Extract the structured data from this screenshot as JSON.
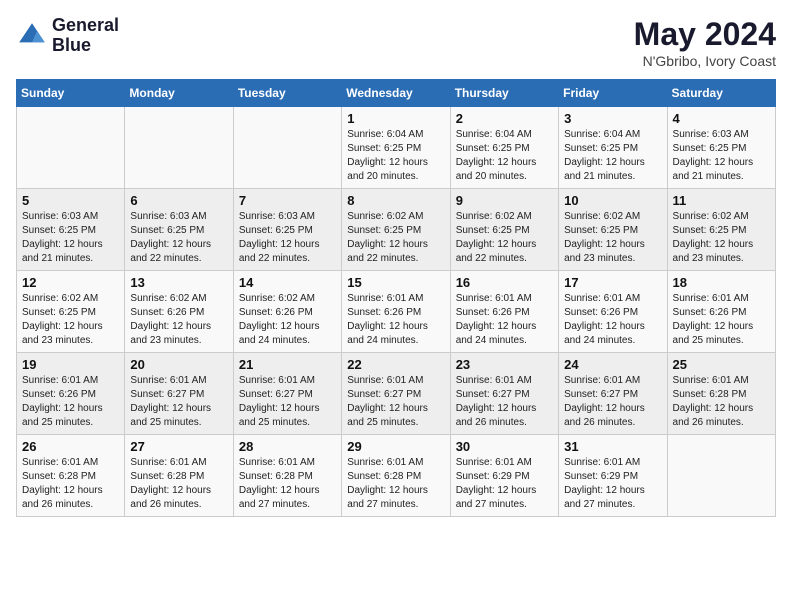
{
  "header": {
    "logo_line1": "General",
    "logo_line2": "Blue",
    "month_year": "May 2024",
    "location": "N'Gbribo, Ivory Coast"
  },
  "weekdays": [
    "Sunday",
    "Monday",
    "Tuesday",
    "Wednesday",
    "Thursday",
    "Friday",
    "Saturday"
  ],
  "weeks": [
    [
      {
        "day": "",
        "sunrise": "",
        "sunset": "",
        "daylight": ""
      },
      {
        "day": "",
        "sunrise": "",
        "sunset": "",
        "daylight": ""
      },
      {
        "day": "",
        "sunrise": "",
        "sunset": "",
        "daylight": ""
      },
      {
        "day": "1",
        "sunrise": "Sunrise: 6:04 AM",
        "sunset": "Sunset: 6:25 PM",
        "daylight": "Daylight: 12 hours and 20 minutes."
      },
      {
        "day": "2",
        "sunrise": "Sunrise: 6:04 AM",
        "sunset": "Sunset: 6:25 PM",
        "daylight": "Daylight: 12 hours and 20 minutes."
      },
      {
        "day": "3",
        "sunrise": "Sunrise: 6:04 AM",
        "sunset": "Sunset: 6:25 PM",
        "daylight": "Daylight: 12 hours and 21 minutes."
      },
      {
        "day": "4",
        "sunrise": "Sunrise: 6:03 AM",
        "sunset": "Sunset: 6:25 PM",
        "daylight": "Daylight: 12 hours and 21 minutes."
      }
    ],
    [
      {
        "day": "5",
        "sunrise": "Sunrise: 6:03 AM",
        "sunset": "Sunset: 6:25 PM",
        "daylight": "Daylight: 12 hours and 21 minutes."
      },
      {
        "day": "6",
        "sunrise": "Sunrise: 6:03 AM",
        "sunset": "Sunset: 6:25 PM",
        "daylight": "Daylight: 12 hours and 22 minutes."
      },
      {
        "day": "7",
        "sunrise": "Sunrise: 6:03 AM",
        "sunset": "Sunset: 6:25 PM",
        "daylight": "Daylight: 12 hours and 22 minutes."
      },
      {
        "day": "8",
        "sunrise": "Sunrise: 6:02 AM",
        "sunset": "Sunset: 6:25 PM",
        "daylight": "Daylight: 12 hours and 22 minutes."
      },
      {
        "day": "9",
        "sunrise": "Sunrise: 6:02 AM",
        "sunset": "Sunset: 6:25 PM",
        "daylight": "Daylight: 12 hours and 22 minutes."
      },
      {
        "day": "10",
        "sunrise": "Sunrise: 6:02 AM",
        "sunset": "Sunset: 6:25 PM",
        "daylight": "Daylight: 12 hours and 23 minutes."
      },
      {
        "day": "11",
        "sunrise": "Sunrise: 6:02 AM",
        "sunset": "Sunset: 6:25 PM",
        "daylight": "Daylight: 12 hours and 23 minutes."
      }
    ],
    [
      {
        "day": "12",
        "sunrise": "Sunrise: 6:02 AM",
        "sunset": "Sunset: 6:25 PM",
        "daylight": "Daylight: 12 hours and 23 minutes."
      },
      {
        "day": "13",
        "sunrise": "Sunrise: 6:02 AM",
        "sunset": "Sunset: 6:26 PM",
        "daylight": "Daylight: 12 hours and 23 minutes."
      },
      {
        "day": "14",
        "sunrise": "Sunrise: 6:02 AM",
        "sunset": "Sunset: 6:26 PM",
        "daylight": "Daylight: 12 hours and 24 minutes."
      },
      {
        "day": "15",
        "sunrise": "Sunrise: 6:01 AM",
        "sunset": "Sunset: 6:26 PM",
        "daylight": "Daylight: 12 hours and 24 minutes."
      },
      {
        "day": "16",
        "sunrise": "Sunrise: 6:01 AM",
        "sunset": "Sunset: 6:26 PM",
        "daylight": "Daylight: 12 hours and 24 minutes."
      },
      {
        "day": "17",
        "sunrise": "Sunrise: 6:01 AM",
        "sunset": "Sunset: 6:26 PM",
        "daylight": "Daylight: 12 hours and 24 minutes."
      },
      {
        "day": "18",
        "sunrise": "Sunrise: 6:01 AM",
        "sunset": "Sunset: 6:26 PM",
        "daylight": "Daylight: 12 hours and 25 minutes."
      }
    ],
    [
      {
        "day": "19",
        "sunrise": "Sunrise: 6:01 AM",
        "sunset": "Sunset: 6:26 PM",
        "daylight": "Daylight: 12 hours and 25 minutes."
      },
      {
        "day": "20",
        "sunrise": "Sunrise: 6:01 AM",
        "sunset": "Sunset: 6:27 PM",
        "daylight": "Daylight: 12 hours and 25 minutes."
      },
      {
        "day": "21",
        "sunrise": "Sunrise: 6:01 AM",
        "sunset": "Sunset: 6:27 PM",
        "daylight": "Daylight: 12 hours and 25 minutes."
      },
      {
        "day": "22",
        "sunrise": "Sunrise: 6:01 AM",
        "sunset": "Sunset: 6:27 PM",
        "daylight": "Daylight: 12 hours and 25 minutes."
      },
      {
        "day": "23",
        "sunrise": "Sunrise: 6:01 AM",
        "sunset": "Sunset: 6:27 PM",
        "daylight": "Daylight: 12 hours and 26 minutes."
      },
      {
        "day": "24",
        "sunrise": "Sunrise: 6:01 AM",
        "sunset": "Sunset: 6:27 PM",
        "daylight": "Daylight: 12 hours and 26 minutes."
      },
      {
        "day": "25",
        "sunrise": "Sunrise: 6:01 AM",
        "sunset": "Sunset: 6:28 PM",
        "daylight": "Daylight: 12 hours and 26 minutes."
      }
    ],
    [
      {
        "day": "26",
        "sunrise": "Sunrise: 6:01 AM",
        "sunset": "Sunset: 6:28 PM",
        "daylight": "Daylight: 12 hours and 26 minutes."
      },
      {
        "day": "27",
        "sunrise": "Sunrise: 6:01 AM",
        "sunset": "Sunset: 6:28 PM",
        "daylight": "Daylight: 12 hours and 26 minutes."
      },
      {
        "day": "28",
        "sunrise": "Sunrise: 6:01 AM",
        "sunset": "Sunset: 6:28 PM",
        "daylight": "Daylight: 12 hours and 27 minutes."
      },
      {
        "day": "29",
        "sunrise": "Sunrise: 6:01 AM",
        "sunset": "Sunset: 6:28 PM",
        "daylight": "Daylight: 12 hours and 27 minutes."
      },
      {
        "day": "30",
        "sunrise": "Sunrise: 6:01 AM",
        "sunset": "Sunset: 6:29 PM",
        "daylight": "Daylight: 12 hours and 27 minutes."
      },
      {
        "day": "31",
        "sunrise": "Sunrise: 6:01 AM",
        "sunset": "Sunset: 6:29 PM",
        "daylight": "Daylight: 12 hours and 27 minutes."
      },
      {
        "day": "",
        "sunrise": "",
        "sunset": "",
        "daylight": ""
      }
    ]
  ]
}
